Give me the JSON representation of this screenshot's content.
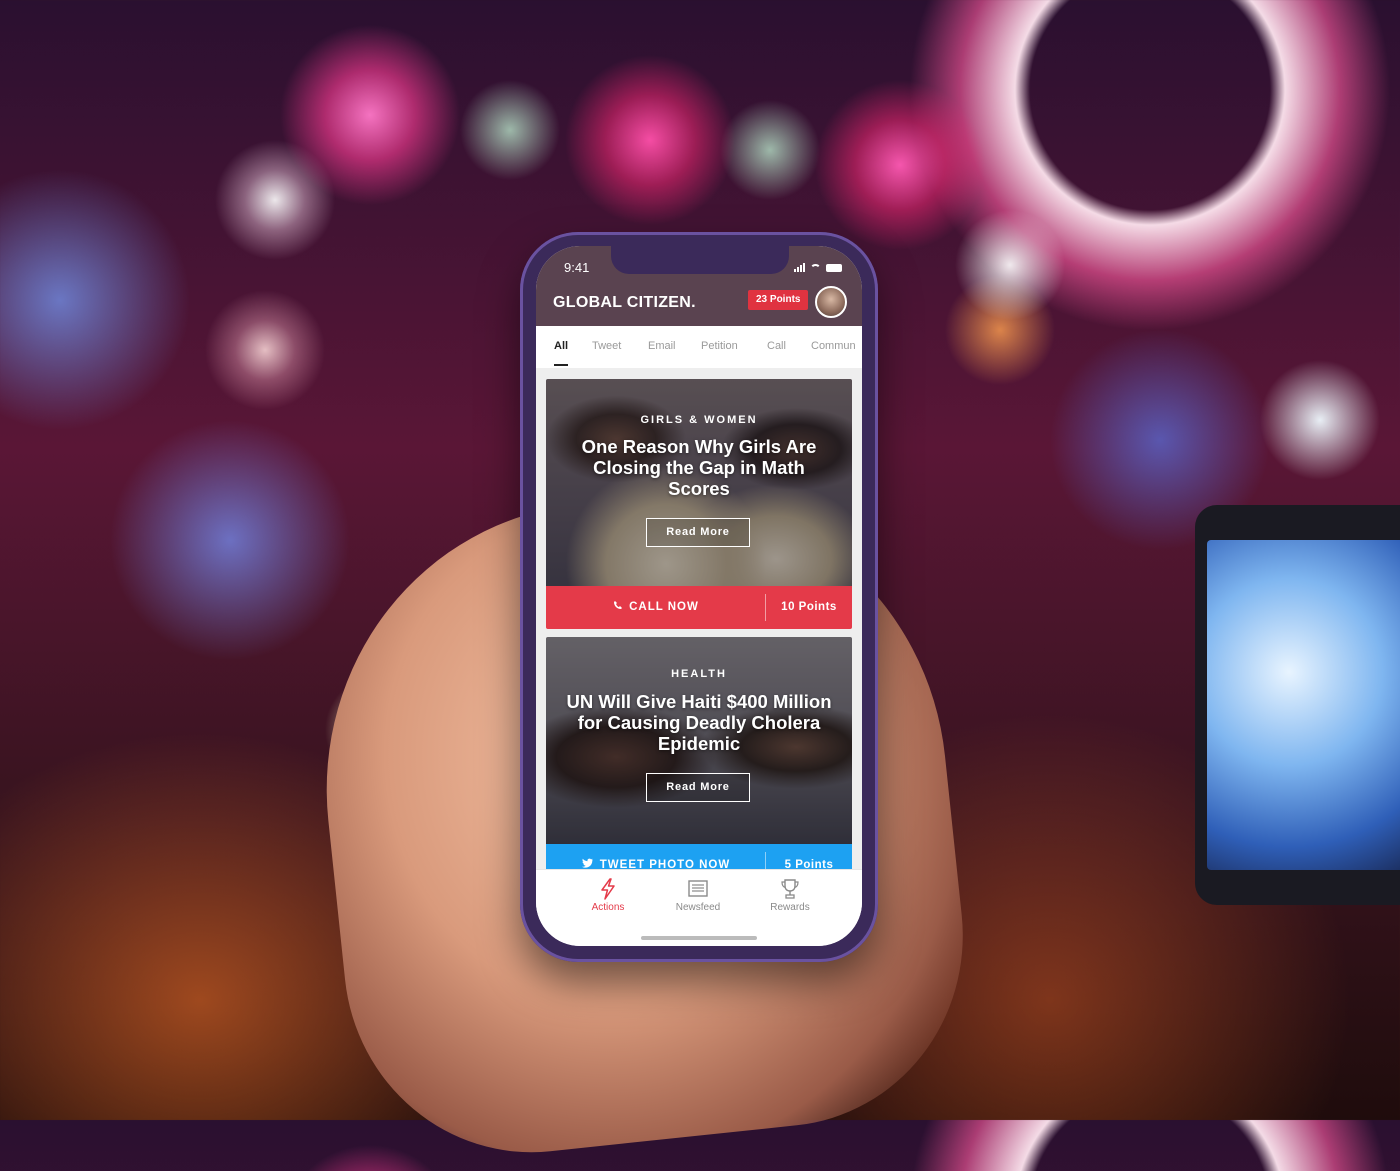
{
  "status_bar": {
    "time": "9:41"
  },
  "header": {
    "logo": "GLOBAL CITIZEN.",
    "points_badge": "23 Points"
  },
  "tabs": [
    {
      "label": "All",
      "active": true
    },
    {
      "label": "Tweet"
    },
    {
      "label": "Email"
    },
    {
      "label": "Petition"
    },
    {
      "label": "Call"
    },
    {
      "label": "Commun"
    }
  ],
  "cards": [
    {
      "category": "GIRLS & WOMEN",
      "headline": "One Reason Why Girls Are Closing the Gap in Math Scores",
      "read_more": "Read More",
      "action_label": "CALL NOW",
      "action_icon": "phone-icon",
      "action_color": "#e43a49",
      "points": "10 Points"
    },
    {
      "category": "HEALTH",
      "headline": "UN Will Give Haiti $400 Million for Causing Deadly Cholera Epidemic",
      "read_more": "Read More",
      "action_label": "TWEET PHOTO NOW",
      "action_icon": "twitter-icon",
      "action_color": "#1da1f2",
      "points": "5 Points"
    }
  ],
  "bottom_nav": [
    {
      "label": "Actions",
      "icon": "lightning-icon",
      "active": true
    },
    {
      "label": "Newsfeed",
      "icon": "newspaper-icon"
    },
    {
      "label": "Rewards",
      "icon": "trophy-icon"
    }
  ],
  "colors": {
    "accent": "#e43a49",
    "twitter": "#1da1f2"
  }
}
